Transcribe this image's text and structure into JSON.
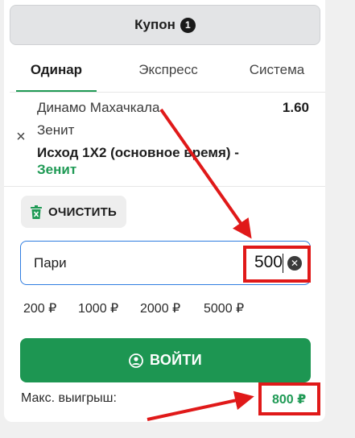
{
  "header": {
    "title": "Купон",
    "badge_count": "1"
  },
  "tabs": [
    {
      "label": "Одинар",
      "active": true
    },
    {
      "label": "Экспресс",
      "active": false
    },
    {
      "label": "Система",
      "active": false
    }
  ],
  "bet": {
    "team1": "Динамо Махачкала",
    "team2": "Зенит",
    "odds": "1.60",
    "market": "Исход 1X2 (основное время) -",
    "selection": "Зенит",
    "remove_icon": "close-icon"
  },
  "clear_button": {
    "label": "ОЧИСТИТЬ",
    "icon": "trash-icon"
  },
  "stake": {
    "label": "Пари",
    "value": "500",
    "clear_icon": "clear-circle-icon"
  },
  "quick_amounts": [
    "200 ₽",
    "1000 ₽",
    "2000 ₽",
    "5000 ₽"
  ],
  "login_button": {
    "label": "ВОЙТИ",
    "icon": "user-circle-icon"
  },
  "max_win": {
    "label": "Макс. выигрыш:",
    "value": "800 ₽"
  },
  "colors": {
    "accent_green": "#1d9652",
    "input_focus": "#2f7de0",
    "annotation_red": "#e01919"
  }
}
